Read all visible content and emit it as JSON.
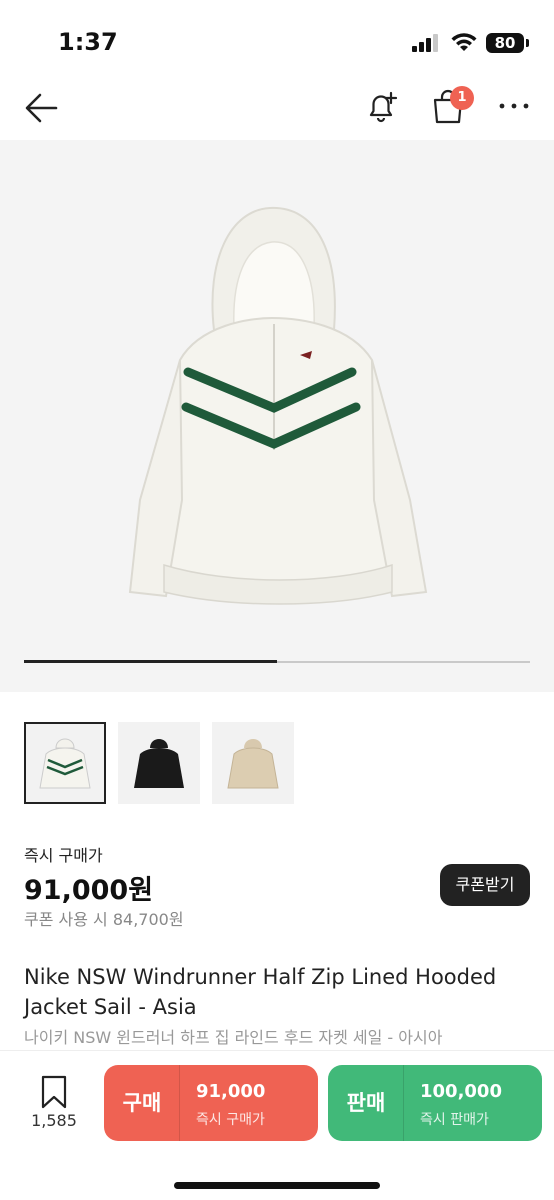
{
  "status_bar": {
    "time": "1:37",
    "battery": "80"
  },
  "nav": {
    "cart_badge": "1"
  },
  "gallery": {
    "progress": 0.5
  },
  "price": {
    "label": "즉시 구매가",
    "value": "91,000원",
    "coupon_text": "쿠폰 사용 시 84,700원",
    "coupon_button": "쿠폰받기"
  },
  "product": {
    "title_en": "Nike NSW Windrunner Half Zip Lined Hooded Jacket Sail - Asia",
    "title_ko": "나이키 NSW 윈드러너 하프 집 라인드 후드 자켓 세일 - 아시아"
  },
  "bottom_bar": {
    "wish_count": "1,585",
    "buy": {
      "tag": "구매",
      "amount": "91,000",
      "sub": "즉시 구매가"
    },
    "sell": {
      "tag": "판매",
      "amount": "100,000",
      "sub": "즉시 판매가"
    }
  }
}
